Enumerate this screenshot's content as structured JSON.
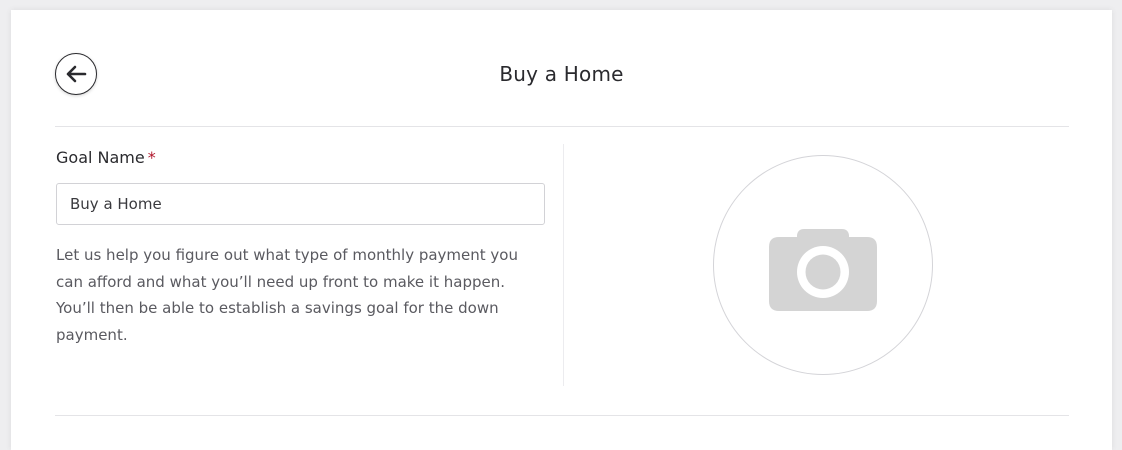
{
  "header": {
    "title": "Buy a Home",
    "back_icon": "arrow-left-icon"
  },
  "form": {
    "goal_name_label": "Goal Name",
    "required_marker": "*",
    "goal_name_value": "Buy a Home",
    "description": "Let us help you figure out what type of monthly payment you can afford and what you’ll need up front to make it happen. You’ll then be able to establish a savings goal for the down payment."
  },
  "photo": {
    "icon": "camera-icon"
  },
  "colors": {
    "required": "#b0162b",
    "text": "#2a2a2e",
    "icon_gray": "#d4d4d4"
  }
}
